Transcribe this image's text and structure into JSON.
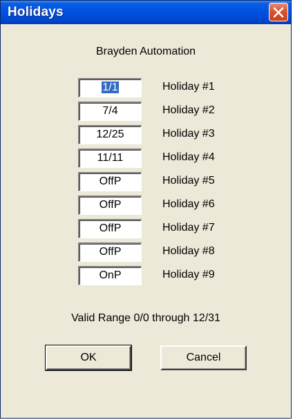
{
  "window": {
    "title": "Holidays"
  },
  "dialog": {
    "company": "Brayden Automation",
    "holidays": [
      {
        "value": "1/1",
        "label": "Holiday #1"
      },
      {
        "value": "7/4",
        "label": "Holiday #2"
      },
      {
        "value": "12/25",
        "label": "Holiday #3"
      },
      {
        "value": "11/11",
        "label": "Holiday #4"
      },
      {
        "value": "OffP",
        "label": "Holiday #5"
      },
      {
        "value": "OffP",
        "label": "Holiday #6"
      },
      {
        "value": "OffP",
        "label": "Holiday #7"
      },
      {
        "value": "OffP",
        "label": "Holiday #8"
      },
      {
        "value": "OnP",
        "label": "Holiday #9"
      }
    ],
    "range_text": "Valid Range 0/0 through 12/31",
    "ok_label": "OK",
    "cancel_label": "Cancel"
  },
  "icons": {
    "close": "close-icon"
  },
  "colors": {
    "titlebar": "#0054e3",
    "close_button": "#d9542f",
    "background": "#ece9d8",
    "selection": "#316ac5"
  }
}
